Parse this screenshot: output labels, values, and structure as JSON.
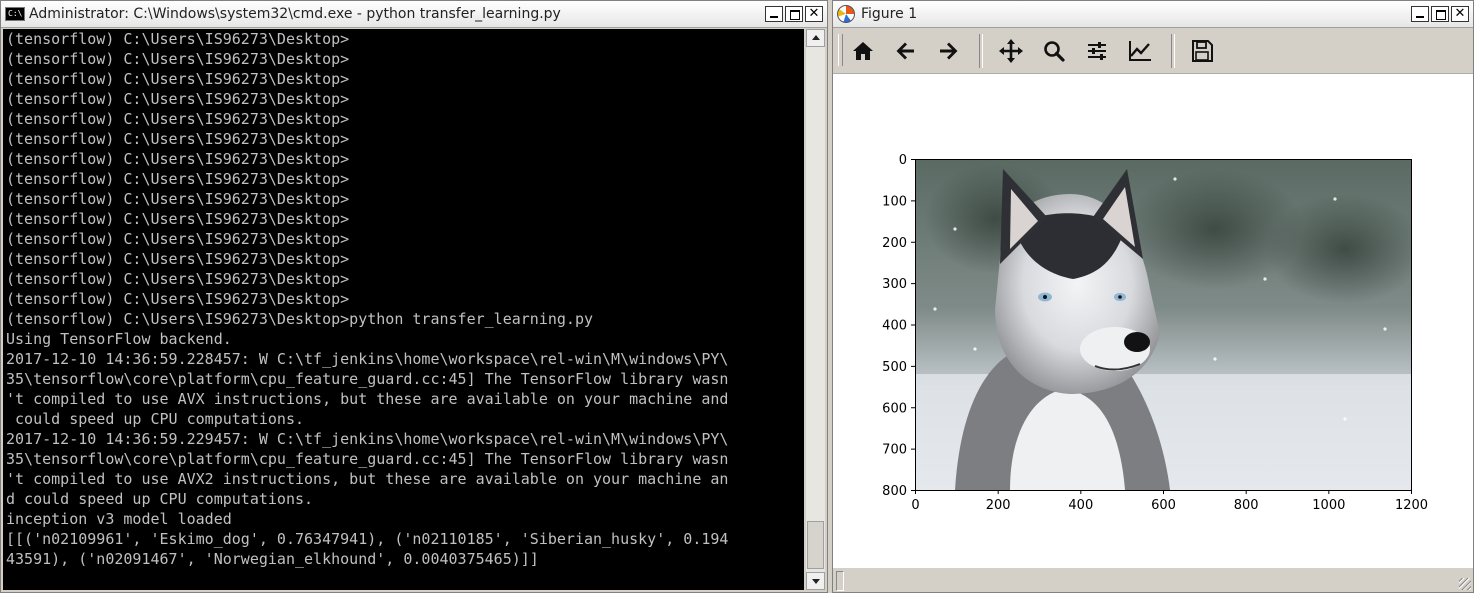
{
  "cmd_window": {
    "title": "Administrator: C:\\Windows\\system32\\cmd.exe - python  transfer_learning.py",
    "icon_text": "C:\\",
    "lines": [
      "(tensorflow) C:\\Users\\IS96273\\Desktop>",
      "(tensorflow) C:\\Users\\IS96273\\Desktop>",
      "(tensorflow) C:\\Users\\IS96273\\Desktop>",
      "(tensorflow) C:\\Users\\IS96273\\Desktop>",
      "(tensorflow) C:\\Users\\IS96273\\Desktop>",
      "(tensorflow) C:\\Users\\IS96273\\Desktop>",
      "(tensorflow) C:\\Users\\IS96273\\Desktop>",
      "(tensorflow) C:\\Users\\IS96273\\Desktop>",
      "(tensorflow) C:\\Users\\IS96273\\Desktop>",
      "(tensorflow) C:\\Users\\IS96273\\Desktop>",
      "(tensorflow) C:\\Users\\IS96273\\Desktop>",
      "(tensorflow) C:\\Users\\IS96273\\Desktop>",
      "(tensorflow) C:\\Users\\IS96273\\Desktop>",
      "(tensorflow) C:\\Users\\IS96273\\Desktop>",
      "(tensorflow) C:\\Users\\IS96273\\Desktop>python transfer_learning.py",
      "Using TensorFlow backend.",
      "2017-12-10 14:36:59.228457: W C:\\tf_jenkins\\home\\workspace\\rel-win\\M\\windows\\PY\\",
      "35\\tensorflow\\core\\platform\\cpu_feature_guard.cc:45] The TensorFlow library wasn",
      "'t compiled to use AVX instructions, but these are available on your machine and",
      " could speed up CPU computations.",
      "2017-12-10 14:36:59.229457: W C:\\tf_jenkins\\home\\workspace\\rel-win\\M\\windows\\PY\\",
      "35\\tensorflow\\core\\platform\\cpu_feature_guard.cc:45] The TensorFlow library wasn",
      "'t compiled to use AVX2 instructions, but these are available on your machine an",
      "d could speed up CPU computations.",
      "inception v3 model loaded",
      "[[('n02109961', 'Eskimo_dog', 0.76347941), ('n02110185', 'Siberian_husky', 0.194",
      "43591), ('n02091467', 'Norwegian_elkhound', 0.0040375465)]]"
    ]
  },
  "figure_window": {
    "title": "Figure 1",
    "toolbar": [
      {
        "name": "home-icon"
      },
      {
        "name": "back-arrow-icon"
      },
      {
        "name": "forward-arrow-icon"
      },
      {
        "name": "pan-icon"
      },
      {
        "name": "zoom-icon"
      },
      {
        "name": "subplots-config-icon"
      },
      {
        "name": "edit-axes-icon"
      },
      {
        "name": "save-icon"
      }
    ]
  },
  "chart_data": {
    "type": "image",
    "content": "photo of a siberian husky in snow",
    "x_ticks": [
      "0",
      "200",
      "400",
      "600",
      "800",
      "1000",
      "1200"
    ],
    "y_ticks": [
      "0",
      "100",
      "200",
      "300",
      "400",
      "500",
      "600",
      "700",
      "800"
    ],
    "xlim": [
      0,
      1200
    ],
    "ylim": [
      800,
      0
    ]
  },
  "window_controls": {
    "min": "_",
    "max": "□",
    "close": "✕"
  }
}
